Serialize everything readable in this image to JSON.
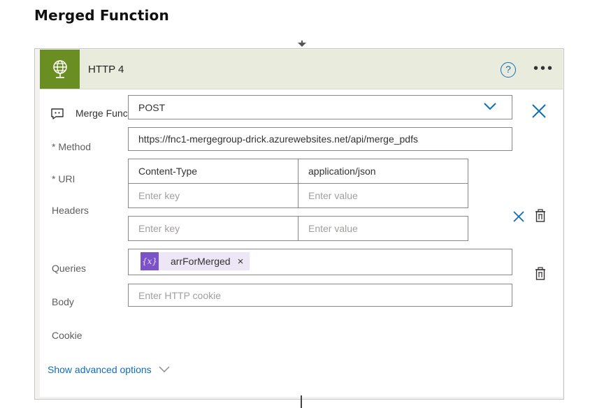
{
  "page_title": "Merged Function",
  "action": {
    "title": "HTTP 4",
    "help_label": "?",
    "more_label": "•••",
    "icon": "globe-icon"
  },
  "comment": {
    "text": "Merge Function",
    "icon": "comment-icon"
  },
  "fields": {
    "method": {
      "label": "* Method",
      "value": "POST"
    },
    "uri": {
      "label": "* URI",
      "value": "https://fnc1-mergegroup-drick.azurewebsites.net/api/merge_pdfs"
    },
    "headers": {
      "label": "Headers",
      "rows": [
        {
          "key": "Content-Type",
          "value": "application/json"
        }
      ],
      "key_placeholder": "Enter key",
      "value_placeholder": "Enter value"
    },
    "queries": {
      "label": "Queries",
      "key_placeholder": "Enter key",
      "value_placeholder": "Enter value"
    },
    "body": {
      "label": "Body",
      "token_icon": "{x}",
      "token_label": "arrForMerged",
      "token_remove": "×"
    },
    "cookie": {
      "label": "Cookie",
      "placeholder": "Enter HTTP cookie"
    }
  },
  "advanced_link": "Show advanced options",
  "colors": {
    "header_bg": "#e9ecdc",
    "icon_bg": "#6b8e23",
    "accent": "#0f6cbd",
    "token_bg": "#ece6f7",
    "token_icon_bg": "#7b52c7"
  }
}
